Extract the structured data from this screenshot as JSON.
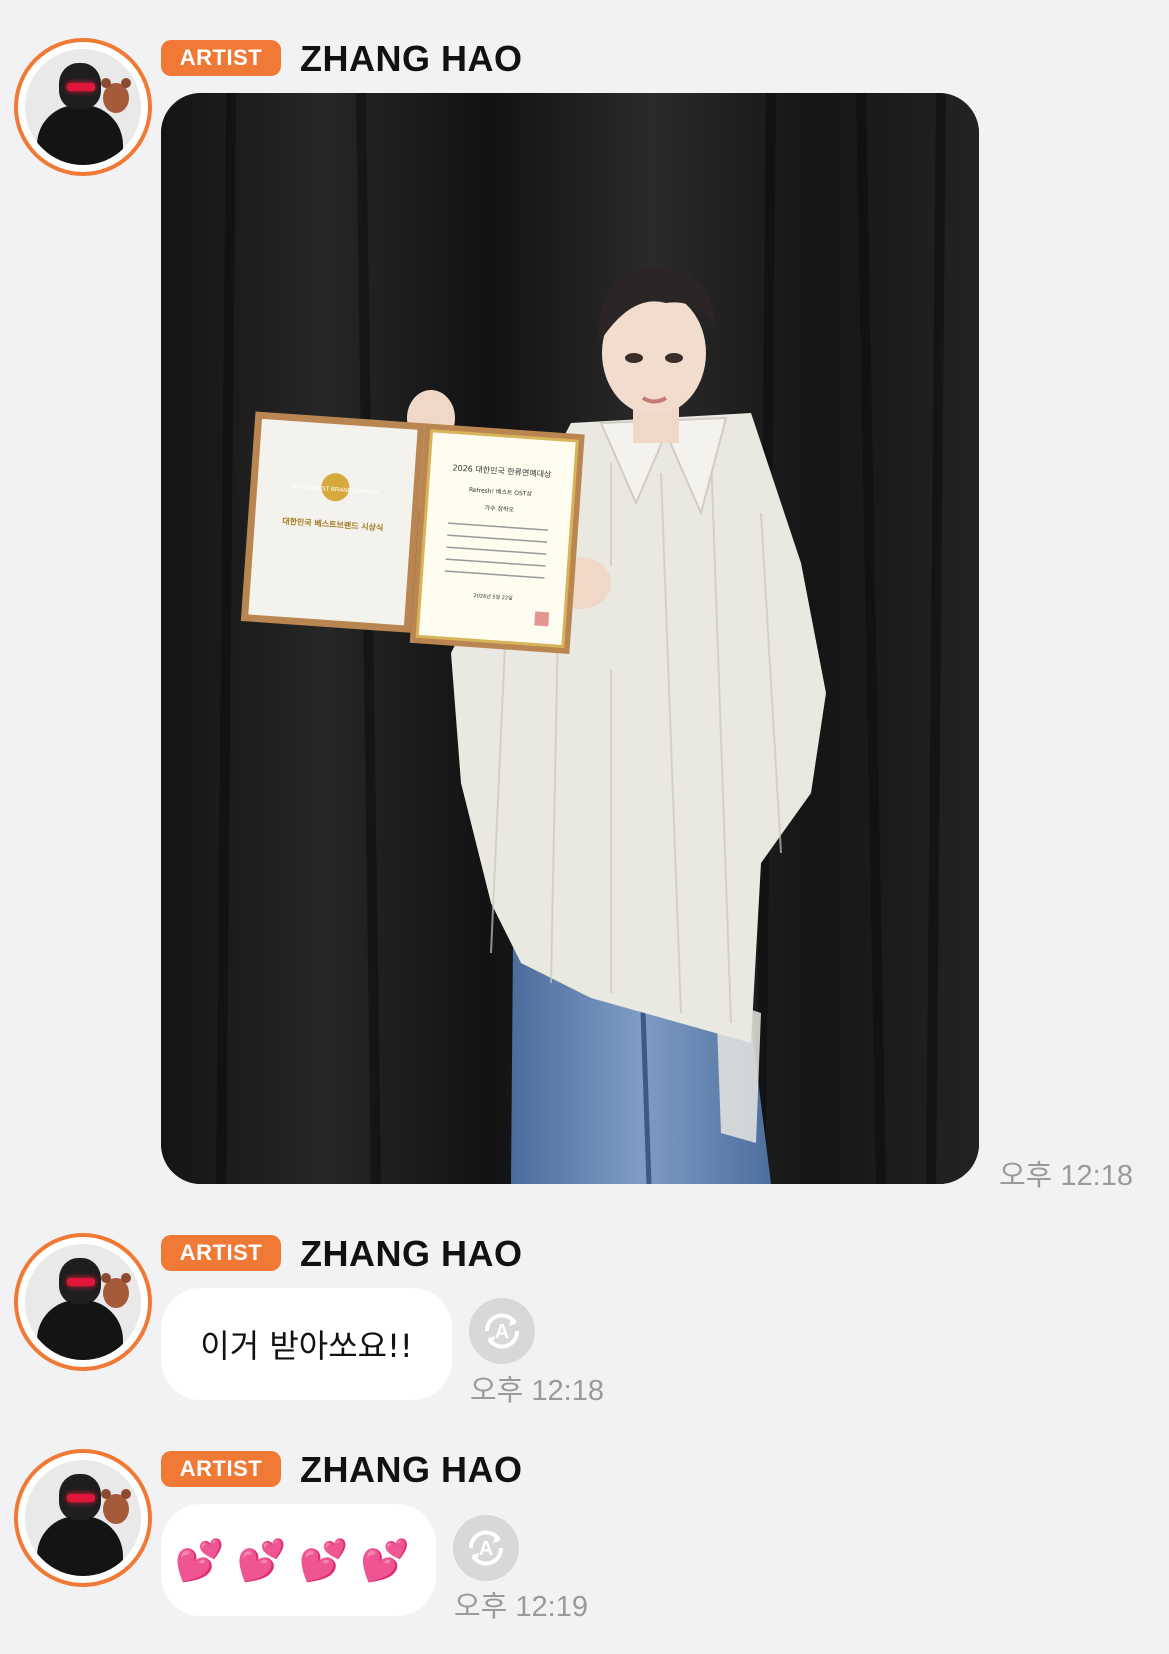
{
  "messages": [
    {
      "badge": "ARTIST",
      "author": "ZHANG HAO",
      "type": "image",
      "image": {
        "certificate_title": "2026 대한민국 한류연예대상",
        "certificate_award": "Refresh! 베스트 OST상",
        "certificate_recipient": "가수 장하오",
        "certificate_date": "2026년 5월 22일",
        "cover_title": "대한민국 베스트브랜드 시상식",
        "cover_logo": "KOREA BEST BRAND AWARDS"
      },
      "time": "오후 12:18"
    },
    {
      "badge": "ARTIST",
      "author": "ZHANG HAO",
      "type": "text",
      "text": "이거 받아쏘요!!",
      "translate_icon": "translate-icon",
      "time": "오후 12:18"
    },
    {
      "badge": "ARTIST",
      "author": "ZHANG HAO",
      "type": "text",
      "text": "💕💕💕💕",
      "translate_icon": "translate-icon",
      "time": "오후 12:19"
    }
  ],
  "colors": {
    "accent": "#f07a35",
    "background": "#f2f2f4",
    "bubble": "#ffffff",
    "timestamp": "#9a9a9c"
  }
}
